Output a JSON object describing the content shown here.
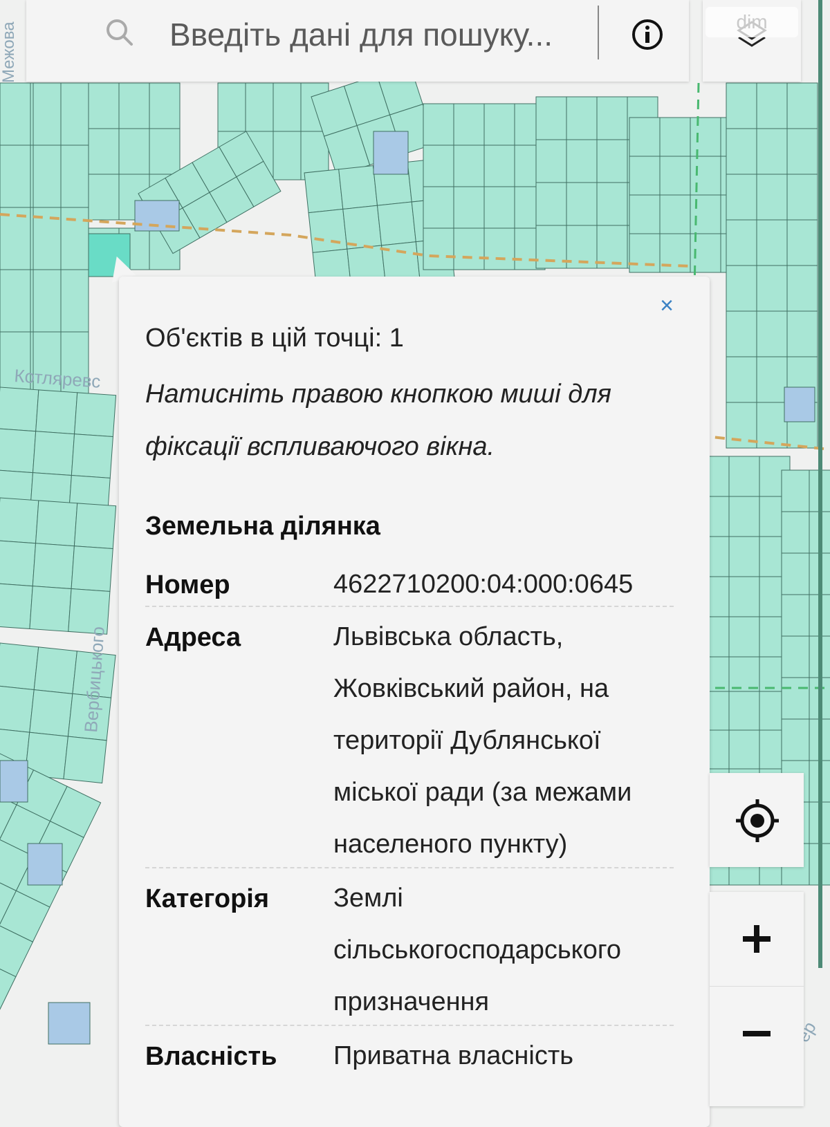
{
  "search": {
    "placeholder": "Введіть дані для пошуку..."
  },
  "icons": {
    "search": "search-icon",
    "info": "info-icon",
    "layers": "layers-icon",
    "close": "close-icon",
    "locate": "locate-icon",
    "zoom_in": "plus-icon",
    "zoom_out": "minus-icon"
  },
  "watermark": "dim",
  "map": {
    "street_labels": [
      "Межова",
      "Котляревс",
      "Вербицького",
      "Гер"
    ],
    "colors": {
      "parcel": "#a8e6d4",
      "parcel_state": "#a9c9e6",
      "parcel_selected": "#69dcc6",
      "road": "#f1f1f1",
      "boundary_dash": "#d4a65c",
      "green_dash": "#49b870"
    }
  },
  "popup": {
    "close_label": "×",
    "objects_count": "Об'єктів в цій точці: 1",
    "hint_lines": [
      "Натисніть правою кнопкою миші для",
      "фіксації вспливаючого вікна."
    ],
    "section_title": "Земельна ділянка",
    "properties": [
      {
        "key": "Номер",
        "lines": [
          "4622710200:04:000:0645"
        ]
      },
      {
        "key": "Адреса",
        "lines": [
          "Львівська область,",
          "Жовківський район, на",
          "території Дублянської",
          "міської ради (за межами",
          "населеного пункту)"
        ]
      },
      {
        "key": "Категорія",
        "lines": [
          "Землі",
          "сільськогосподарського",
          "призначення"
        ]
      },
      {
        "key": "Власність",
        "lines": [
          "Приватна власність"
        ]
      }
    ]
  },
  "controls": {
    "zoom_in_label": "+",
    "zoom_out_label": "−"
  }
}
